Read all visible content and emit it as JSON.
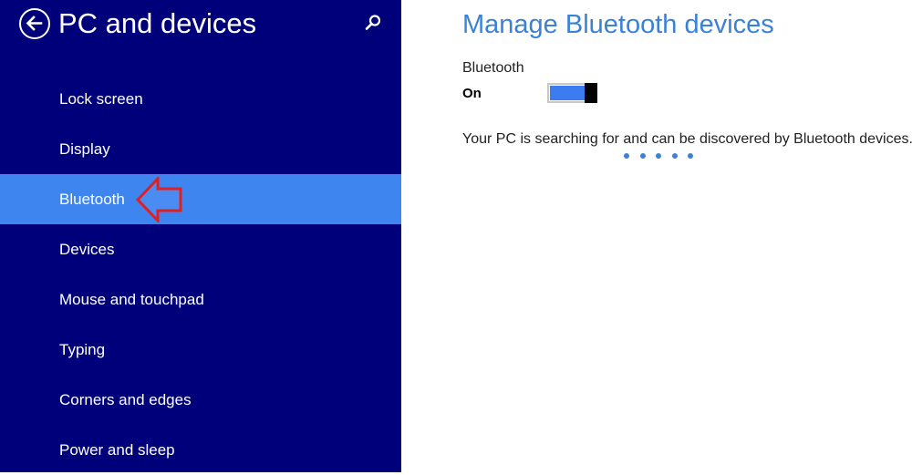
{
  "nav": {
    "title": "PC and devices",
    "back_icon": "back-arrow-icon",
    "search_icon": "search-icon",
    "items": [
      {
        "label": "Lock screen"
      },
      {
        "label": "Display"
      },
      {
        "label": "Bluetooth",
        "selected": true
      },
      {
        "label": "Devices"
      },
      {
        "label": "Mouse and touchpad"
      },
      {
        "label": "Typing"
      },
      {
        "label": "Corners and edges"
      },
      {
        "label": "Power and sleep"
      }
    ]
  },
  "content": {
    "title": "Manage Bluetooth devices",
    "bluetooth_label": "Bluetooth",
    "bluetooth_state": "On",
    "status_text": "Your PC is searching for and can be discovered by Bluetooth devices."
  },
  "annotation": {
    "icon": "red-arrow-icon",
    "color": "#e02020"
  },
  "colors": {
    "nav_bg": "#00007a",
    "selected_bg": "#3f85f0",
    "accent": "#3b82d6",
    "toggle_fill": "#3b7cf0"
  }
}
